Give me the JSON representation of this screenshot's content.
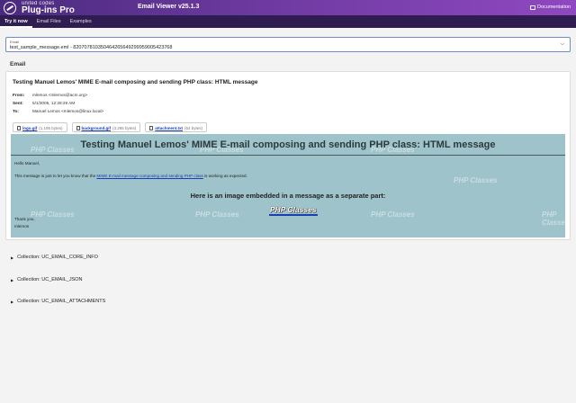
{
  "brand": {
    "top": "united codes",
    "main": "Plug-ins Pro"
  },
  "app_title": "Email Viewer v25.1.3",
  "doc_link": "Documentation",
  "tabs": [
    {
      "label": "Try it now"
    },
    {
      "label": "Email Files"
    },
    {
      "label": "Examples"
    }
  ],
  "email_select": {
    "label": "Email",
    "value": "test_sample_message.eml - 820707810350464265649299959005423768"
  },
  "section_title": "Email",
  "email": {
    "subject": "Testing Manuel Lemos' MIME E-mail composing and sending PHP class: HTML message",
    "from_label": "From:",
    "from": "mlemos <mlemos@acm.org>",
    "sent_label": "Sent:",
    "sent": "5/1/2005, 12:28:29 AM",
    "to_label": "To:",
    "to": "Manuel Lemos <mlemos@linux.local>",
    "attachments": [
      {
        "name": "logo.gif",
        "size": "(1,195 bytes)"
      },
      {
        "name": "background.gif",
        "size": "(3,265 bytes)"
      },
      {
        "name": "attachment.txt",
        "size": "(64 bytes)"
      }
    ],
    "body": {
      "heading": "Testing Manuel Lemos' MIME E-mail composing and sending PHP class: HTML message",
      "greeting": "Hello Manuel,",
      "line_prefix": "This message is just to let you know that the",
      "line_link": "MIME E-mail message composing and sending PHP class",
      "line_suffix": "is working as expected.",
      "subheading": "Here is an image embedded in a message as a separate part:",
      "embedded_image_text": "PHP Classes",
      "signoff": "Thank you,",
      "signature": "mlemos",
      "watermark": "PHP Classes"
    }
  },
  "collections": [
    {
      "label": "Collection: UC_EMAIL_CORE_INFO"
    },
    {
      "label": "Collection: UC_EMAIL_JSON"
    },
    {
      "label": "Collection: UC_EMAIL_ATTACHMENTS"
    }
  ]
}
